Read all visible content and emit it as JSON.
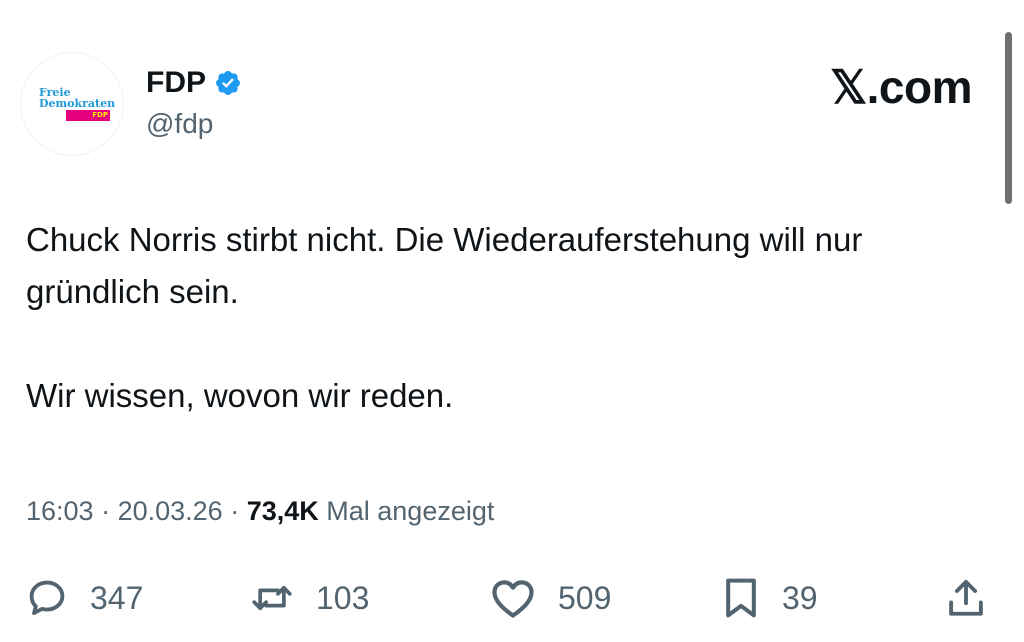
{
  "author": {
    "display_name": "FDP",
    "handle": "@fdp",
    "verified": true,
    "avatar_logo": {
      "line1": "Freie",
      "line2": "Demokraten",
      "tag": "FDP"
    }
  },
  "brand": "𝕏.com",
  "tweet": {
    "paragraphs": [
      "Chuck Norris stirbt nicht. Die Wiederauferstehung will nur gründlich sein.",
      "Wir wissen, wovon wir reden."
    ],
    "time": "16:03",
    "date": "20.03.26",
    "separator": " · ",
    "views_count": "73,4K",
    "views_label": "Mal angezeigt"
  },
  "actions": {
    "replies": "347",
    "reposts": "103",
    "likes": "509",
    "bookmarks": "39"
  },
  "colors": {
    "text": "#0f1419",
    "secondary": "#536471",
    "verified_blue": "#1d9bf0",
    "fdp_blue": "#1f9bd7",
    "fdp_magenta": "#e5007d",
    "fdp_yellow": "#ffed00"
  },
  "icons": [
    "verified-badge-icon",
    "reply-icon",
    "repost-icon",
    "like-icon",
    "bookmark-icon",
    "share-icon"
  ]
}
